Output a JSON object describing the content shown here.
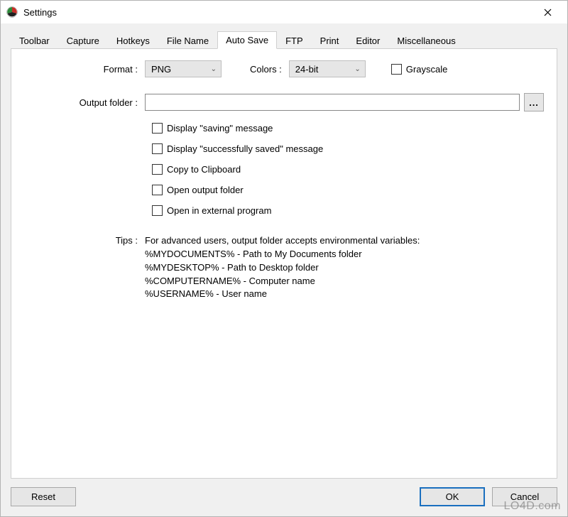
{
  "window": {
    "title": "Settings"
  },
  "tabs": [
    {
      "label": "Toolbar"
    },
    {
      "label": "Capture"
    },
    {
      "label": "Hotkeys"
    },
    {
      "label": "File Name"
    },
    {
      "label": "Auto Save",
      "active": true
    },
    {
      "label": "FTP"
    },
    {
      "label": "Print"
    },
    {
      "label": "Editor"
    },
    {
      "label": "Miscellaneous"
    }
  ],
  "form": {
    "format_label": "Format :",
    "format_value": "PNG",
    "colors_label": "Colors :",
    "colors_value": "24-bit",
    "grayscale_label": "Grayscale",
    "output_folder_label": "Output folder :",
    "output_folder_value": "",
    "browse_label": "...",
    "opt1": "Display \"saving\" message",
    "opt2": "Display \"successfully saved\" message",
    "opt3": "Copy to Clipboard",
    "opt4": "Open output folder",
    "opt5": "Open in external program",
    "tips_label": "Tips :",
    "tips_intro": "For advanced users, output folder accepts environmental variables:",
    "tips_l1": "%MYDOCUMENTS% - Path to My Documents folder",
    "tips_l2": "%MYDESKTOP% - Path to Desktop folder",
    "tips_l3": "%COMPUTERNAME% - Computer name",
    "tips_l4": "%USERNAME% - User name"
  },
  "buttons": {
    "reset": "Reset",
    "ok": "OK",
    "cancel": "Cancel"
  },
  "watermark": "LO4D.com"
}
